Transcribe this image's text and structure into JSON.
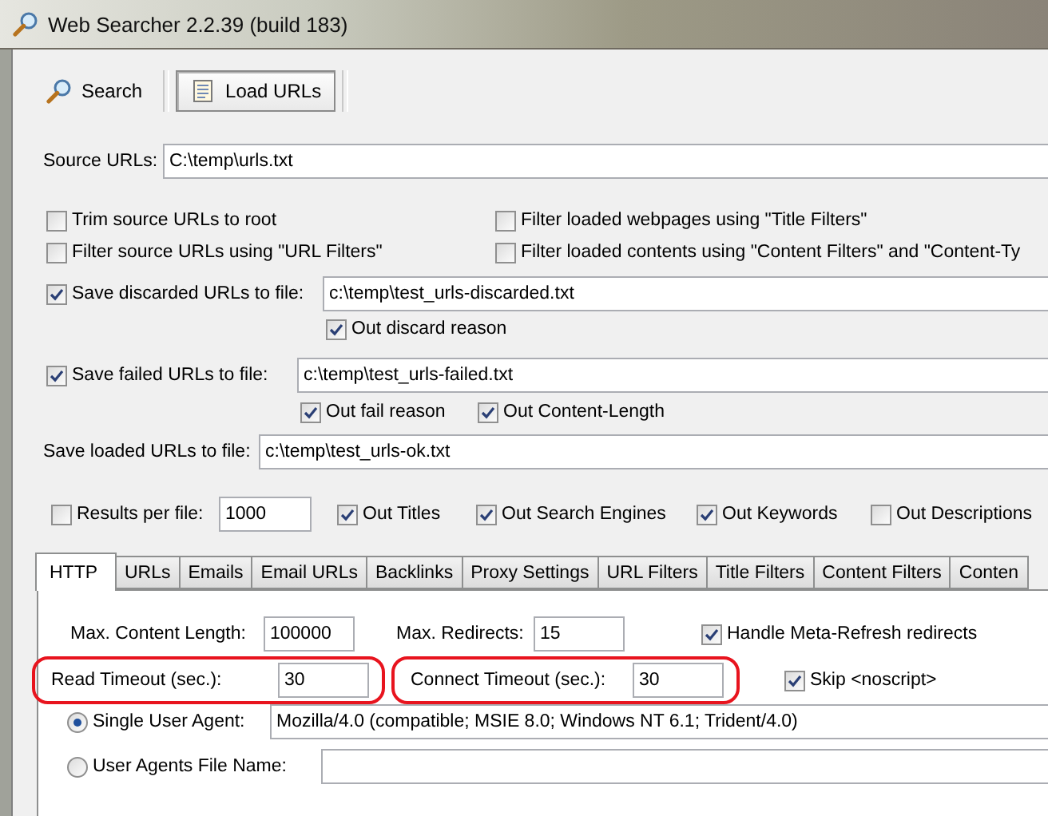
{
  "window": {
    "title": "Web Searcher 2.2.39 (build 183)"
  },
  "toolbar": [
    {
      "label": "Search",
      "kind": "search",
      "selected": false
    },
    {
      "label": "Load URLs",
      "kind": "list",
      "selected": true
    }
  ],
  "source_urls": {
    "label": "Source URLs:",
    "value": "C:\\temp\\urls.txt"
  },
  "filter_options": [
    {
      "label": "Trim source URLs to root",
      "checked": false
    },
    {
      "label": "Filter loaded webpages using \"Title Filters\"",
      "checked": false
    },
    {
      "label": "Filter source URLs using \"URL Filters\"",
      "checked": false
    },
    {
      "label": "Filter loaded contents using \"Content Filters\" and \"Content-Ty",
      "checked": false
    }
  ],
  "save_discarded": {
    "label": "Save discarded URLs to file:",
    "checked": true,
    "value": "c:\\temp\\test_urls-discarded.txt",
    "options": [
      {
        "label": "Out discard reason",
        "checked": true
      }
    ]
  },
  "save_failed": {
    "label": "Save failed URLs to file:",
    "checked": true,
    "value": "c:\\temp\\test_urls-failed.txt",
    "options": [
      {
        "label": "Out fail reason",
        "checked": true
      },
      {
        "label": "Out Content-Length",
        "checked": true
      }
    ]
  },
  "save_loaded": {
    "label": "Save loaded URLs to file:",
    "value": "c:\\temp\\test_urls-ok.txt"
  },
  "results_per_file": {
    "label": "Results per file:",
    "checked": false,
    "value": "1000"
  },
  "output_options": [
    {
      "label": "Out Titles",
      "checked": true
    },
    {
      "label": "Out Search Engines",
      "checked": true
    },
    {
      "label": "Out Keywords",
      "checked": true
    },
    {
      "label": "Out Descriptions",
      "checked": false
    }
  ],
  "tabs": [
    {
      "label": "HTTP",
      "selected": true
    },
    {
      "label": "URLs",
      "selected": false
    },
    {
      "label": "Emails",
      "selected": false
    },
    {
      "label": "Email URLs",
      "selected": false
    },
    {
      "label": "Backlinks",
      "selected": false
    },
    {
      "label": "Proxy Settings",
      "selected": false
    },
    {
      "label": "URL Filters",
      "selected": false
    },
    {
      "label": "Title Filters",
      "selected": false
    },
    {
      "label": "Content Filters",
      "selected": false
    },
    {
      "label": "Conten",
      "selected": false
    }
  ],
  "http_panel": {
    "rows": [
      {
        "fields": [
          {
            "label": "Max. Content Length:",
            "value": "100000",
            "highlighted": false
          },
          {
            "label": "Max. Redirects:",
            "value": "15",
            "highlighted": false
          }
        ],
        "check": {
          "label": "Handle Meta-Refresh redirects",
          "checked": true
        }
      },
      {
        "fields": [
          {
            "label": "Read Timeout (sec.):",
            "value": "30",
            "highlighted": true
          },
          {
            "label": "Connect Timeout (sec.):",
            "value": "30",
            "highlighted": true
          }
        ],
        "check": {
          "label": "Skip <noscript>",
          "checked": true
        }
      }
    ],
    "user_agent": [
      {
        "label": "Single User Agent:",
        "selected": true,
        "value": "Mozilla/4.0 (compatible; MSIE 8.0; Windows NT 6.1; Trident/4.0)"
      },
      {
        "label": "User Agents File Name:",
        "selected": false
      }
    ]
  }
}
